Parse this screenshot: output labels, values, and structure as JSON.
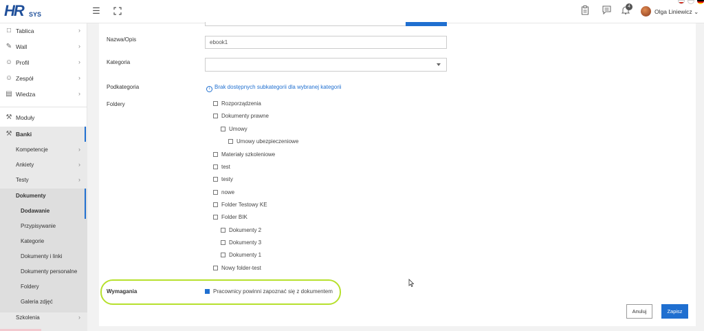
{
  "header": {
    "logo_main": "HR",
    "logo_sub": "SYS",
    "notifications_count": "4",
    "user_name": "Olga Liniewicz ⌄"
  },
  "sidebar": {
    "items": [
      {
        "label": "Tablica"
      },
      {
        "label": "Wall"
      },
      {
        "label": "Profil"
      },
      {
        "label": "Zespół"
      },
      {
        "label": "Wiedza"
      },
      {
        "label": "Moduły"
      },
      {
        "label": "Banki"
      }
    ],
    "banki_sub": [
      {
        "label": "Kompetencje"
      },
      {
        "label": "Ankiety"
      },
      {
        "label": "Testy"
      },
      {
        "label": "Dokumenty"
      },
      {
        "label": "Szkolenia"
      }
    ],
    "dokumenty_sub": [
      {
        "label": "Dodawanie"
      },
      {
        "label": "Przypisywanie"
      },
      {
        "label": "Kategorie"
      },
      {
        "label": "Dokumenty i linki"
      },
      {
        "label": "Dokumenty personalne"
      },
      {
        "label": "Foldery"
      },
      {
        "label": "Galeria zdjęć"
      }
    ]
  },
  "form": {
    "name_label": "Nazwa/Opis",
    "name_value": "ebook1",
    "category_label": "Kategoria",
    "category_value": "",
    "subcategory_label": "Podkategoria",
    "subcategory_info": "Brak dostępnych subkategorii dla wybranej kategorii",
    "folders_label": "Foldery",
    "folders": [
      {
        "label": "Rozporządzenia"
      },
      {
        "label": "Dokumenty prawne"
      },
      {
        "label": "Umowy"
      },
      {
        "label": "Umowy ubezpieczeniowe"
      },
      {
        "label": "Materiały szkoleniowe"
      },
      {
        "label": "test"
      },
      {
        "label": "testy"
      },
      {
        "label": "nowe"
      },
      {
        "label": "Folder Testowy KE"
      },
      {
        "label": "Folder BIK"
      },
      {
        "label": "Dokumenty 2"
      },
      {
        "label": "Dokumenty 3"
      },
      {
        "label": "Dokumenty 1"
      },
      {
        "label": "Nowy folder-test"
      }
    ],
    "requirements_label": "Wymagania",
    "requirements_checkbox": "Pracownicy powinni zapoznać się z dokumentem",
    "requirements_checked": true,
    "cancel_label": "Anuluj",
    "save_label": "Zapisz"
  },
  "colors": {
    "accent": "#1f6fd0",
    "highlight": "#b6e02c"
  }
}
